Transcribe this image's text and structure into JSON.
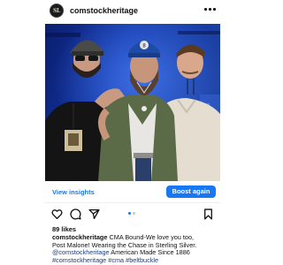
{
  "post": {
    "avatar_initials": "SL",
    "username": "comstockheritage",
    "more_icon": "more-horizontal-icon",
    "photo_alt": "Three men posing together on a concert stage",
    "photo_hat_patch": "8",
    "insights_label": "View insights",
    "boost_label": "Boost again",
    "likes": "89 likes",
    "caption": {
      "username": "comstockheritage",
      "line1": " CMA Bound-We love you too,",
      "line2": "Post Malone! Wearing the Chase in Sterling Silver.",
      "mention": "@comstockheritage",
      "line3_rest": " American Made Since 1886",
      "hashtags": "#comstockheritage #cma #beltbuckle"
    },
    "carousel": {
      "total": 2,
      "active": 1
    },
    "colors": {
      "accent": "#1877f2",
      "hashtag": "#1c3f7a",
      "active_dot": "#1877f2",
      "inactive_dot": "#c7c7c7"
    }
  }
}
